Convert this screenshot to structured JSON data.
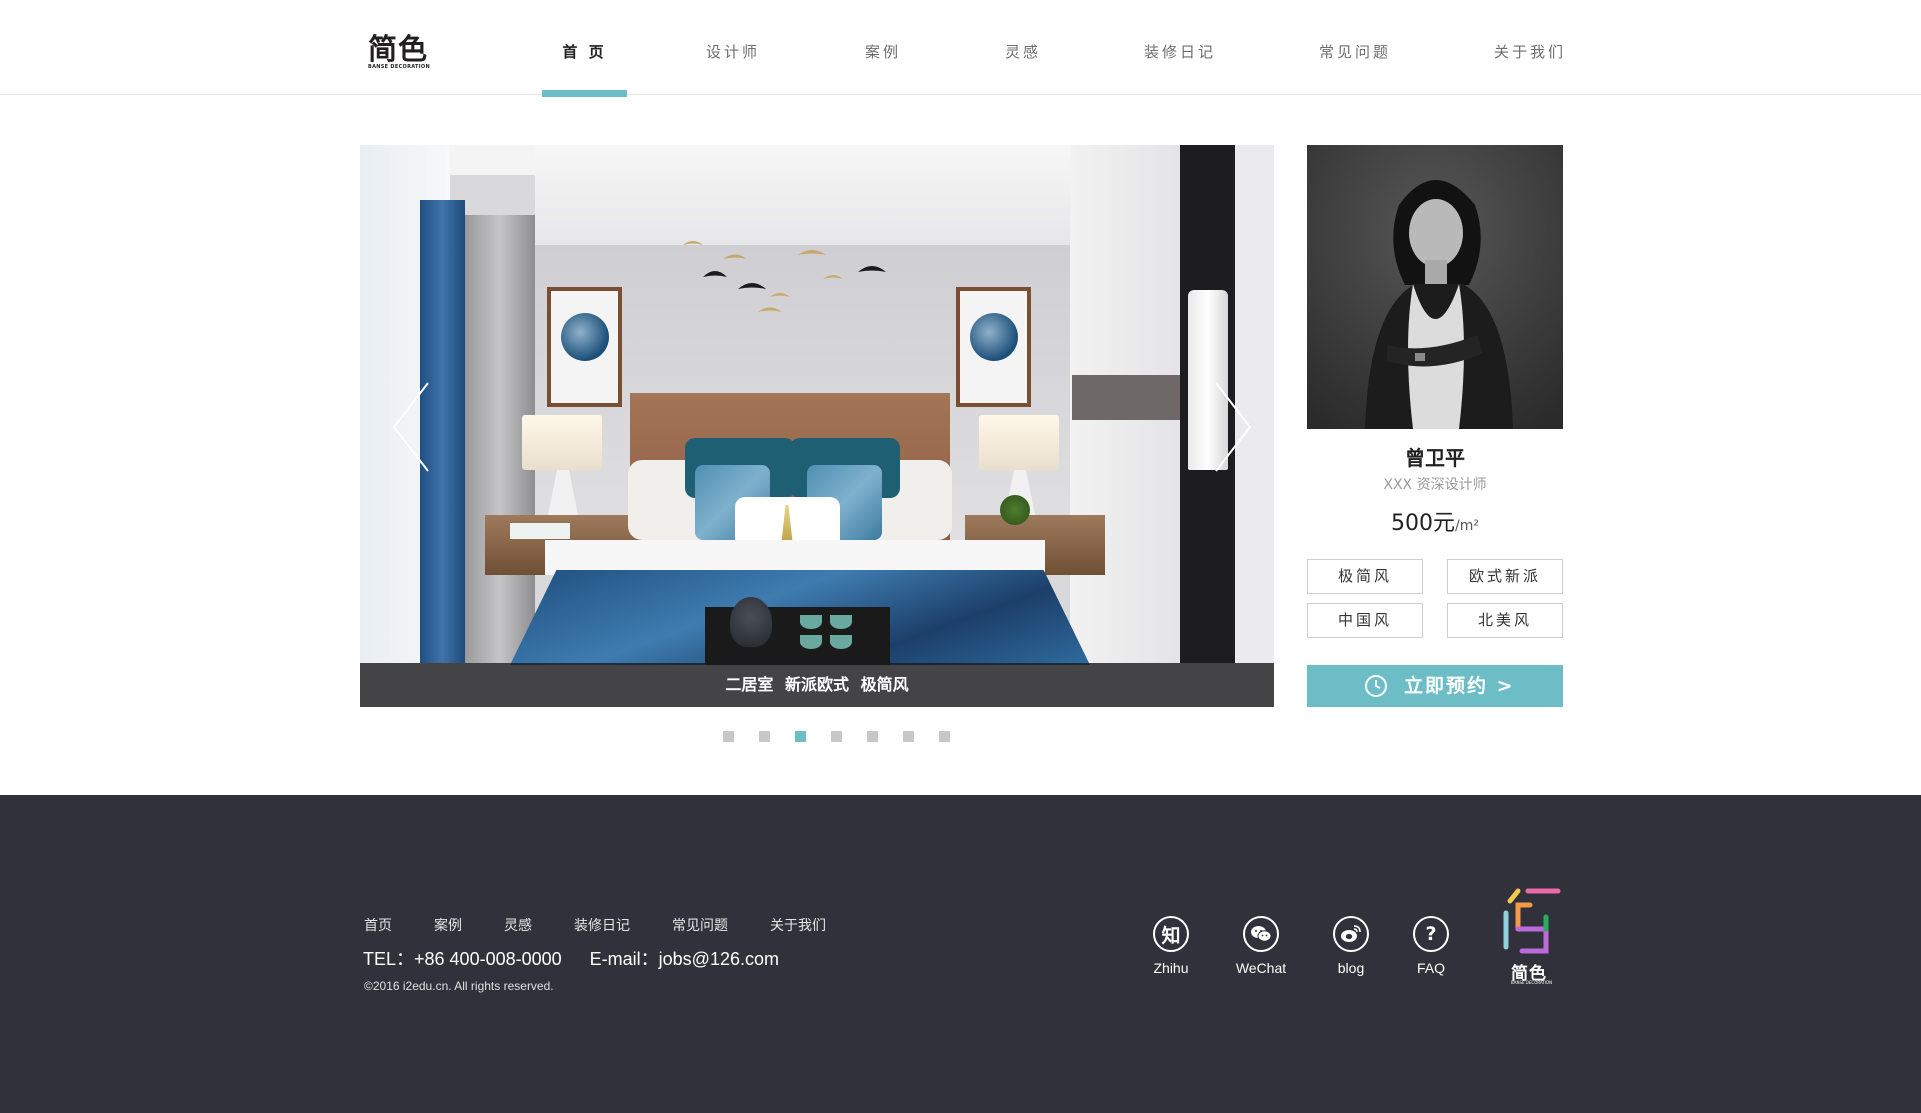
{
  "brand": {
    "logo_text": "简色",
    "logo_sub": "BANSE DECORATION"
  },
  "nav": {
    "items": [
      {
        "label": "首 页",
        "active": true
      },
      {
        "label": "设计师"
      },
      {
        "label": "案例"
      },
      {
        "label": "灵感"
      },
      {
        "label": "装修日记"
      },
      {
        "label": "常见问题"
      },
      {
        "label": "关于我们"
      }
    ]
  },
  "hero": {
    "caption": "二居室 新派欧式 极简风",
    "slide_count": 7,
    "active_slide": 3
  },
  "designer": {
    "name": "曾卫平",
    "title": "XXX 资深设计师",
    "price_value": "500元",
    "price_unit": "/m²",
    "styles": [
      "极简风",
      "欧式新派",
      "中国风",
      "北美风"
    ],
    "book_label": "立即预约  >"
  },
  "footer": {
    "links": [
      "首页",
      "案例",
      "灵感",
      "装修日记",
      "常见问题",
      "关于我们"
    ],
    "tel": "TEL：+86 400-008-0000",
    "email": "E-mail：jobs@126.com",
    "copyright": "©2016 i2edu.cn. All rights reserved.",
    "social": [
      {
        "label": "Zhihu",
        "glyph": "知",
        "icon": "zhihu-icon"
      },
      {
        "label": "WeChat",
        "glyph": "",
        "icon": "wechat-icon"
      },
      {
        "label": "blog",
        "glyph": "",
        "icon": "weibo-icon"
      },
      {
        "label": "FAQ",
        "glyph": "?",
        "icon": "question-icon"
      }
    ],
    "logo_text": "简色",
    "logo_sub": "BANSE DECORATION"
  },
  "colors": {
    "accent": "#6cbdc6",
    "footer_bg": "#30313a",
    "text_dark": "#222222",
    "text_muted": "#9a9a9a"
  }
}
